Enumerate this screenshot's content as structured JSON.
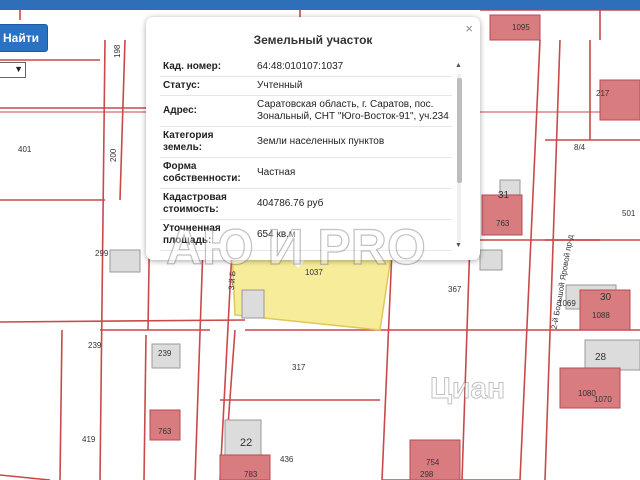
{
  "toolbar": {
    "find_label": "Найти"
  },
  "popup": {
    "title": "Земельный участок",
    "close_glyph": "×",
    "rows": [
      {
        "key": "Кад. номер:",
        "value": "64:48:010107:1037"
      },
      {
        "key": "Статус:",
        "value": "Учтенный"
      },
      {
        "key": "Адрес:",
        "value": "Саратовская область, г. Саратов, пос. Зональный, СНТ \"Юго-Восток-91\", уч.234"
      },
      {
        "key": "Категория земель:",
        "value": "Земли населенных пунктов"
      },
      {
        "key": "Форма собственности:",
        "value": "Частная"
      },
      {
        "key": "Кадастровая стоимость:",
        "value": "404786.76 руб"
      },
      {
        "key": "Уточненная площадь:",
        "value": "654 кв.м"
      }
    ]
  },
  "map": {
    "parcel_labels": [
      "198",
      "1095",
      "217",
      "401",
      "200",
      "8/4",
      "31",
      "763",
      "501",
      "299",
      "1037",
      "367",
      "1069",
      "30",
      "1088",
      "239",
      "239",
      "317",
      "28",
      "1080",
      "1070",
      "419",
      "763",
      "436",
      "22",
      "783",
      "754",
      "298"
    ],
    "street_labels": [
      "3-й Б",
      "2-й Большой Яровой пр-д"
    ],
    "colors": {
      "highlight": "#f7ec9a",
      "building": "#d97c80",
      "lines": "#c84a4a"
    }
  },
  "watermark": {
    "text": "АЮ И PRO",
    "text2": "Циан"
  }
}
